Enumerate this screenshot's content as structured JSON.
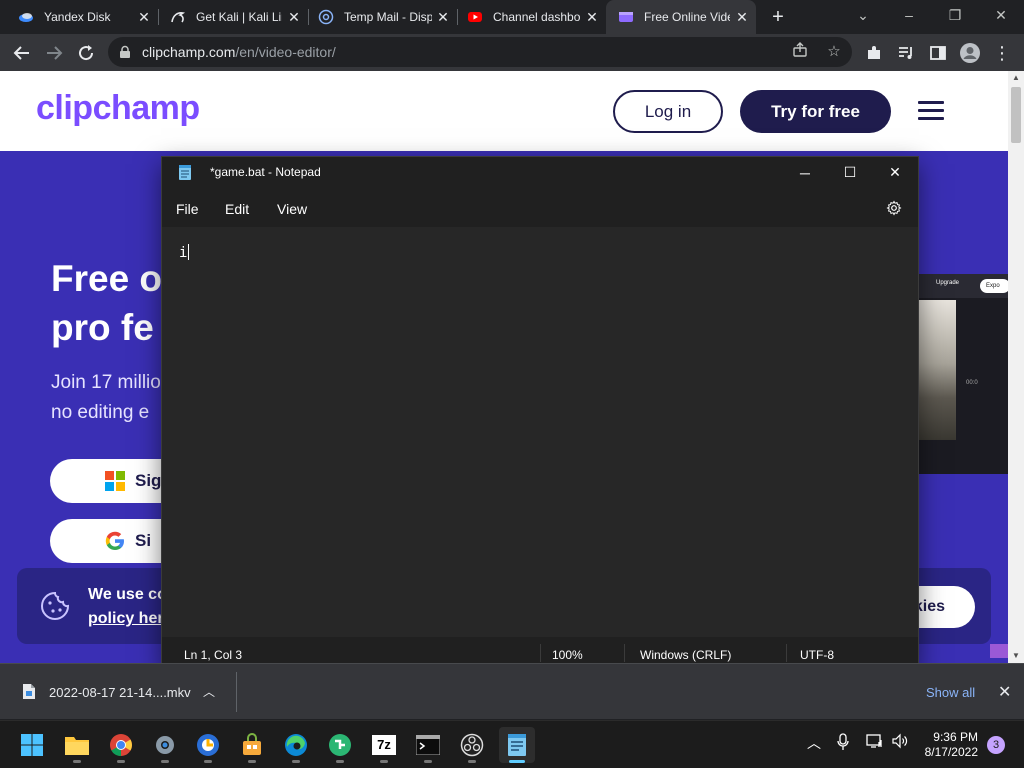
{
  "browser": {
    "tabs": [
      {
        "title": "Yandex Disk",
        "icon": "yandex-disk-icon"
      },
      {
        "title": "Get Kali | Kali Lin",
        "icon": "kali-dragon-icon"
      },
      {
        "title": "Temp Mail - Disp",
        "icon": "at-sign-icon"
      },
      {
        "title": "Channel dashbo",
        "icon": "youtube-icon"
      },
      {
        "title": "Free Online Vide",
        "icon": "clipchamp-icon",
        "active": true
      }
    ],
    "new_tab": "+",
    "window_controls": {
      "minimize": "–",
      "restore": "❐",
      "close": "✕",
      "tab_search": "⌄"
    },
    "url_host": "clipchamp.com",
    "url_path": "/en/video-editor/"
  },
  "page": {
    "logo_text": "clipchamp",
    "login_label": "Log in",
    "try_label": "Try for free",
    "hero_heading": "Free o\npro fe",
    "hero_text": "Join 17 millio\nno editing e",
    "signin_microsoft": "Sig",
    "signin_google": "Si",
    "cookie_text": "We use co",
    "cookie_link": "policy her",
    "cookie_button": "kies",
    "preview": {
      "upgrade": "Upgrade",
      "export": "Expo",
      "time": "00:0"
    },
    "colors": {
      "hero_bg": "#3a2fb4",
      "brand_purple": "#7b4dff",
      "navy": "#1f1c4d"
    }
  },
  "notepad": {
    "title": "*game.bat - Notepad",
    "menu": [
      "File",
      "Edit",
      "View"
    ],
    "content": "i",
    "status": {
      "position": "Ln 1, Col 3",
      "zoom": "100%",
      "line_ending": "Windows (CRLF)",
      "encoding": "UTF-8"
    }
  },
  "downloads": {
    "file_name": "2022-08-17 21-14....mkv",
    "show_all": "Show all"
  },
  "taskbar": {
    "apps": [
      "start-icon",
      "file-explorer-icon",
      "chrome-icon",
      "settings-icon",
      "brave-browser-icon",
      "store-icon",
      "edge-icon",
      "ninjastar-icon",
      "7zip-icon",
      "terminal-icon",
      "obs-icon",
      "notepad-icon"
    ],
    "time": "9:36 PM",
    "date": "8/17/2022",
    "notification_count": "3",
    "seven_zip_label": "7z"
  }
}
